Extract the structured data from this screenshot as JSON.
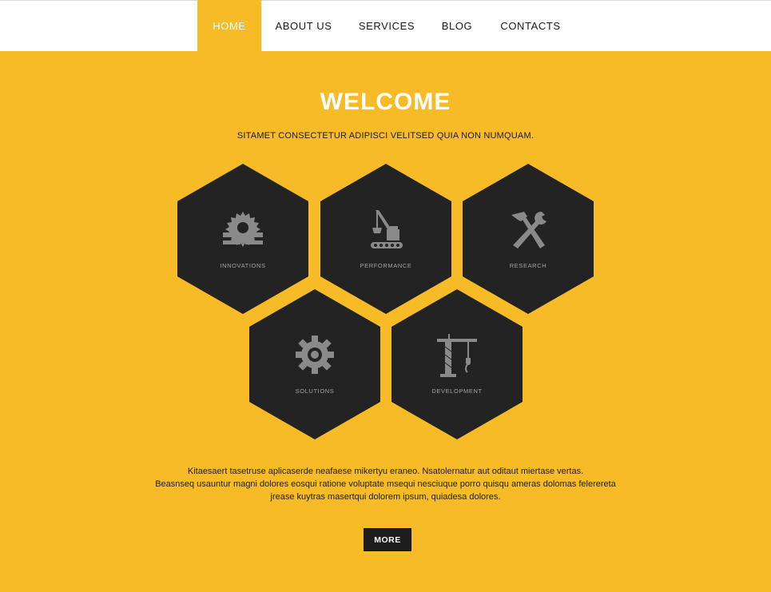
{
  "nav": {
    "items": [
      {
        "label": "HOME",
        "active": true
      },
      {
        "label": "ABOUT US",
        "active": false
      },
      {
        "label": "SERVICES",
        "active": false
      },
      {
        "label": "BLOG",
        "active": false
      },
      {
        "label": "CONTACTS",
        "active": false
      }
    ]
  },
  "hero": {
    "title": "WELCOME",
    "subtitle": "SITAMET CONSECTETUR ADIPISCI VELITSED QUIA NON NUMQUAM."
  },
  "features": [
    {
      "label": "INNOVATIONS",
      "icon": "saw-blade-icon"
    },
    {
      "label": "PERFORMANCE",
      "icon": "excavator-crane-icon"
    },
    {
      "label": "RESEARCH",
      "icon": "hammer-wrench-icon"
    },
    {
      "label": "SOLUTIONS",
      "icon": "gear-icon"
    },
    {
      "label": "DEVELOPMENT",
      "icon": "tower-crane-icon"
    }
  ],
  "body": {
    "lines": [
      "Kitaesaert tasetruse aplicaserde neafaese mikertyu eraneo. Nsatolernatur aut oditaut miertase vertas.",
      "Beasnseq usauntur magni dolores eosqui ratione voluptate msequi nesciuque porro quisqu ameras dolomas felerereta",
      "jrease kuytras masertqui dolorem ipsum, quiadesa dolores."
    ],
    "more_label": "MORE"
  },
  "colors": {
    "accent": "#f6bb26",
    "hex": "#232323",
    "icon": "#8a8a8a",
    "nav_bg": "#ffffff"
  }
}
